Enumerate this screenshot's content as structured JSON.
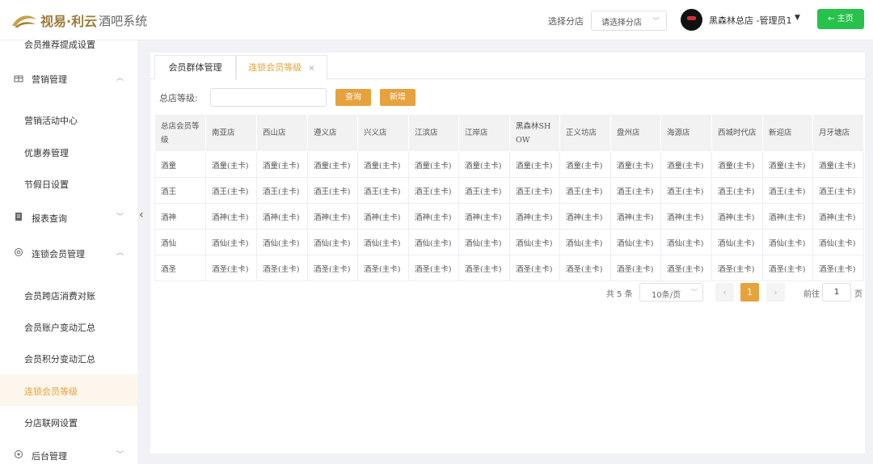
{
  "header": {
    "logo_brand": "视易·利云",
    "logo_sub": "酒吧系统",
    "branch_label": "选择分店",
    "branch_placeholder": "请选择分店",
    "user_name": "黑森林总店 -管理员1",
    "home_button": "← 主页"
  },
  "sidebar": {
    "items": [
      {
        "label": "会员推荐提成设置",
        "type": "item"
      },
      {
        "label": "营销管理",
        "type": "group",
        "icon": "gift-icon",
        "arrow": "chevron-up"
      },
      {
        "label": "营销活动中心",
        "type": "item"
      },
      {
        "label": "优惠券管理",
        "type": "item"
      },
      {
        "label": "节假日设置",
        "type": "item"
      },
      {
        "label": "报表查询",
        "type": "group",
        "icon": "report-icon",
        "arrow": "chevron-down"
      },
      {
        "label": "连锁会员管理",
        "type": "group",
        "icon": "members-icon",
        "arrow": "chevron-up"
      },
      {
        "label": "会员跨店消费对账",
        "type": "item"
      },
      {
        "label": "会员账户变动汇总",
        "type": "item"
      },
      {
        "label": "会员积分变动汇总",
        "type": "item"
      },
      {
        "label": "连锁会员等级",
        "type": "item",
        "active": true
      },
      {
        "label": "分店联网设置",
        "type": "item"
      },
      {
        "label": "后台管理",
        "type": "group",
        "icon": "settings-icon",
        "arrow": "chevron-down"
      }
    ]
  },
  "tabs": [
    {
      "label": "会员群体管理"
    },
    {
      "label": "连锁会员等级",
      "close": "×",
      "active": true
    }
  ],
  "filter": {
    "label": "总店等级:",
    "query_button": "查询",
    "add_button": "新增"
  },
  "table": {
    "headers": [
      "总店会员等级",
      "南亚店",
      "西山店",
      "遵义店",
      "兴义店",
      "江滨店",
      "江岸店",
      "黑森林SHOW",
      "正义坊店",
      "盘州店",
      "海源店",
      "西城时代店",
      "新迎店",
      "月牙塘店"
    ],
    "rows": [
      [
        "酒童",
        "酒童(主卡)",
        "酒童(主卡)",
        "酒童(主卡)",
        "酒童(主卡)",
        "酒童(主卡)",
        "酒童(主卡)",
        "酒童(主卡)",
        "酒童(主卡)",
        "酒童(主卡)",
        "酒童(主卡)",
        "酒童(主卡)",
        "酒童(主卡)",
        "酒童(主卡)"
      ],
      [
        "酒王",
        "酒王(主卡)",
        "酒王(主卡)",
        "酒王(主卡)",
        "酒王(主卡)",
        "酒王(主卡)",
        "酒王(主卡)",
        "酒王(主卡)",
        "酒王(主卡)",
        "酒王(主卡)",
        "酒王(主卡)",
        "酒王(主卡)",
        "酒王(主卡)",
        "酒王(主卡)"
      ],
      [
        "酒神",
        "酒神(主卡)",
        "酒神(主卡)",
        "酒神(主卡)",
        "酒神(主卡)",
        "酒神(主卡)",
        "酒神(主卡)",
        "酒神(主卡)",
        "酒神(主卡)",
        "酒神(主卡)",
        "酒神(主卡)",
        "酒神(主卡)",
        "酒神(主卡)",
        "酒神(主卡)"
      ],
      [
        "酒仙",
        "酒仙(主卡)",
        "酒仙(主卡)",
        "酒仙(主卡)",
        "酒仙(主卡)",
        "酒仙(主卡)",
        "酒仙(主卡)",
        "酒仙(主卡)",
        "酒仙(主卡)",
        "酒仙(主卡)",
        "酒仙(主卡)",
        "酒仙(主卡)",
        "酒仙(主卡)",
        "酒仙(主卡)"
      ],
      [
        "酒圣",
        "酒圣(主卡)",
        "酒圣(主卡)",
        "酒圣(主卡)",
        "酒圣(主卡)",
        "酒圣(主卡)",
        "酒圣(主卡)",
        "酒圣(主卡)",
        "酒圣(主卡)",
        "酒圣(主卡)",
        "酒圣(主卡)",
        "酒圣(主卡)",
        "酒圣(主卡)",
        "酒圣(主卡)"
      ]
    ]
  },
  "pagination": {
    "total": "共 5 条",
    "page_size": "10条/页",
    "prev": "‹",
    "current": "1",
    "next": "›",
    "goto_label": "前往",
    "goto_value": "1",
    "page_suffix": "页"
  },
  "colors": {
    "accent": "#e6a23c",
    "home_button": "#27c24c"
  }
}
